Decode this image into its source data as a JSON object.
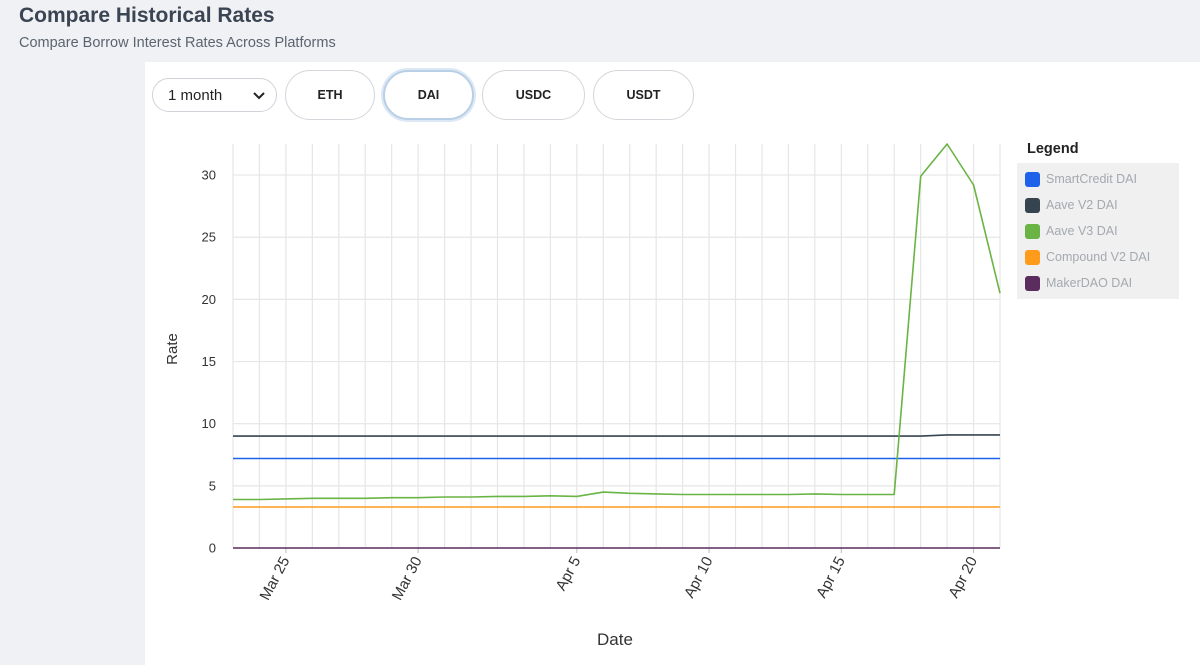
{
  "header": {
    "title": "Compare Historical Rates",
    "subtitle": "Compare Borrow Interest Rates Across Platforms"
  },
  "controls": {
    "period": "1 month",
    "tokens": [
      {
        "label": "ETH",
        "active": false
      },
      {
        "label": "DAI",
        "active": true
      },
      {
        "label": "USDC",
        "active": false
      },
      {
        "label": "USDT",
        "active": false
      }
    ]
  },
  "legend": {
    "title": "Legend"
  },
  "chart_data": {
    "type": "line",
    "xlabel": "Date",
    "ylabel": "Rate",
    "ylim": [
      0,
      32.5
    ],
    "yticks": [
      0,
      5,
      10,
      15,
      20,
      25,
      30
    ],
    "xlim": [
      "2023-03-23",
      "2023-04-21"
    ],
    "xticks": [
      {
        "date": "2023-03-25",
        "label": "Mar 25"
      },
      {
        "date": "2023-03-30",
        "label": "Mar 30"
      },
      {
        "date": "2023-04-05",
        "label": "Apr 5"
      },
      {
        "date": "2023-04-10",
        "label": "Apr 10"
      },
      {
        "date": "2023-04-15",
        "label": "Apr 15"
      },
      {
        "date": "2023-04-20",
        "label": "Apr 20"
      }
    ],
    "grid": true,
    "legend_position": "right",
    "x": [
      "2023-03-23",
      "2023-03-24",
      "2023-03-25",
      "2023-03-26",
      "2023-03-27",
      "2023-03-28",
      "2023-03-29",
      "2023-03-30",
      "2023-03-31",
      "2023-04-01",
      "2023-04-02",
      "2023-04-03",
      "2023-04-04",
      "2023-04-05",
      "2023-04-06",
      "2023-04-07",
      "2023-04-08",
      "2023-04-09",
      "2023-04-10",
      "2023-04-11",
      "2023-04-12",
      "2023-04-13",
      "2023-04-14",
      "2023-04-15",
      "2023-04-16",
      "2023-04-17",
      "2023-04-18",
      "2023-04-19",
      "2023-04-20",
      "2023-04-21"
    ],
    "series": [
      {
        "name": "SmartCredit DAI",
        "color": "#1d62e8",
        "values": [
          7.2,
          7.2,
          7.2,
          7.2,
          7.2,
          7.2,
          7.2,
          7.2,
          7.2,
          7.2,
          7.2,
          7.2,
          7.2,
          7.2,
          7.2,
          7.2,
          7.2,
          7.2,
          7.2,
          7.2,
          7.2,
          7.2,
          7.2,
          7.2,
          7.2,
          7.2,
          7.2,
          7.2,
          7.2,
          7.2
        ]
      },
      {
        "name": "Aave V2 DAI",
        "color": "#36444f",
        "values": [
          9,
          9,
          9,
          9,
          9,
          9,
          9,
          9,
          9,
          9,
          9,
          9,
          9,
          9,
          9,
          9,
          9,
          9,
          9,
          9,
          9,
          9,
          9,
          9,
          9,
          9,
          9,
          9.1,
          9.1,
          9.1
        ]
      },
      {
        "name": "Aave V3 DAI",
        "color": "#6ab446",
        "values": [
          3.9,
          3.9,
          3.95,
          4.0,
          4.0,
          4.0,
          4.05,
          4.05,
          4.1,
          4.1,
          4.15,
          4.15,
          4.2,
          4.15,
          4.5,
          4.4,
          4.35,
          4.3,
          4.3,
          4.3,
          4.3,
          4.3,
          4.35,
          4.3,
          4.3,
          4.3,
          29.9,
          32.5,
          29.2,
          20.5
        ]
      },
      {
        "name": "Compound V2 DAI",
        "color": "#ff9b1a",
        "values": [
          3.3,
          3.3,
          3.3,
          3.3,
          3.3,
          3.3,
          3.3,
          3.3,
          3.3,
          3.3,
          3.3,
          3.3,
          3.3,
          3.3,
          3.3,
          3.3,
          3.3,
          3.3,
          3.3,
          3.3,
          3.3,
          3.3,
          3.3,
          3.3,
          3.3,
          3.3,
          3.3,
          3.3,
          3.3,
          3.3
        ]
      },
      {
        "name": "MakerDAO DAI",
        "color": "#5a2d5e",
        "values": [
          0,
          0,
          0,
          0,
          0,
          0,
          0,
          0,
          0,
          0,
          0,
          0,
          0,
          0,
          0,
          0,
          0,
          0,
          0,
          0,
          0,
          0,
          0,
          0,
          0,
          0,
          0,
          0,
          0,
          0
        ]
      }
    ]
  }
}
